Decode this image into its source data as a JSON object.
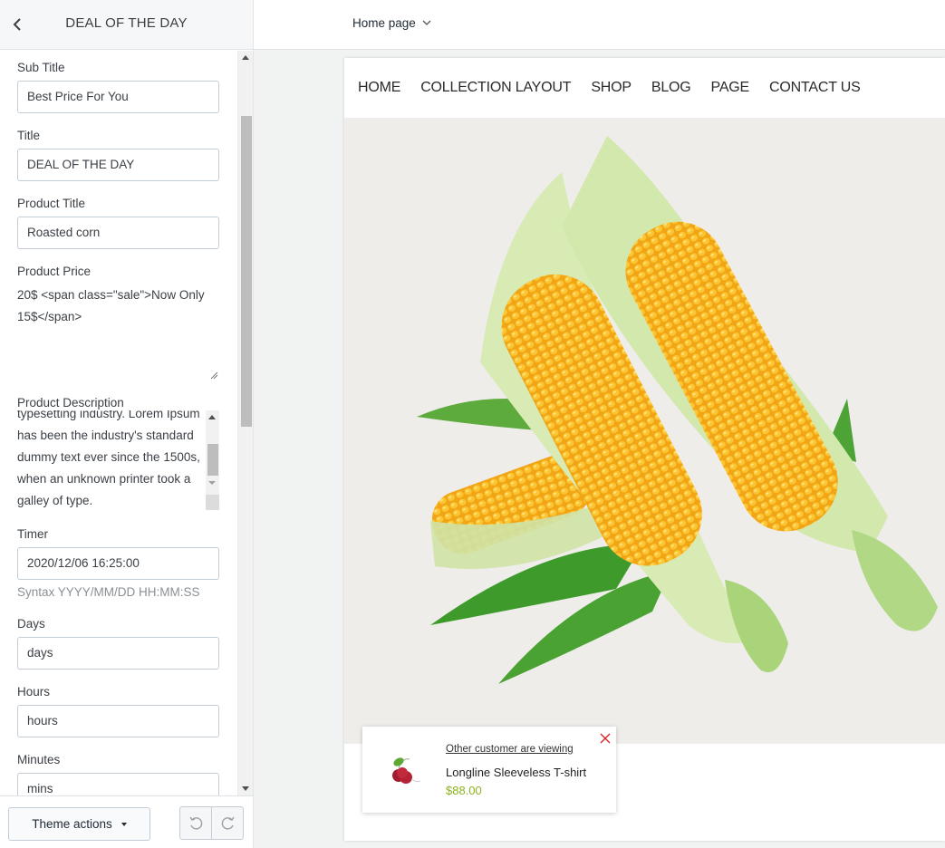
{
  "sidebar": {
    "title": "DEAL OF THE DAY",
    "back_icon": "chevron-left-icon",
    "fields": {
      "sub_title": {
        "label": "Sub Title",
        "value": "Best Price For You"
      },
      "title": {
        "label": "Title",
        "value": "DEAL OF THE DAY"
      },
      "product_title": {
        "label": "Product Title",
        "value": "Roasted corn"
      },
      "product_price": {
        "label": "Product Price",
        "value": "20$ <span class=\"sale\">Now Only 15$</span>"
      },
      "product_description": {
        "label": "Product Description",
        "value": "typesetting industry. Lorem Ipsum has been the industry's standard dummy text ever since the 1500s, when an unknown printer took a galley of type."
      },
      "timer": {
        "label": "Timer",
        "value": "2020/12/06 16:25:00",
        "hint": "Syntax YYYY/MM/DD HH:MM:SS"
      },
      "days": {
        "label": "Days",
        "value": "days"
      },
      "hours": {
        "label": "Hours",
        "value": "hours"
      },
      "minutes": {
        "label": "Minutes",
        "value": "mins"
      }
    },
    "footer": {
      "theme_actions_label": "Theme actions",
      "undo_icon": "undo-icon",
      "redo_icon": "redo-icon"
    }
  },
  "topbar": {
    "page_selector": "Home page"
  },
  "preview": {
    "nav": [
      "HOME",
      "COLLECTION LAYOUT",
      "SHOP",
      "BLOG",
      "PAGE",
      "CONTACT US"
    ],
    "hero_image": "corn-cobs-image",
    "popup": {
      "viewing_text": "Other customer are viewing",
      "product_name": "Longline Sleeveless T-shirt",
      "price": "$88.00",
      "price_color": "#8cb31f",
      "close_color": "#e02020"
    }
  }
}
